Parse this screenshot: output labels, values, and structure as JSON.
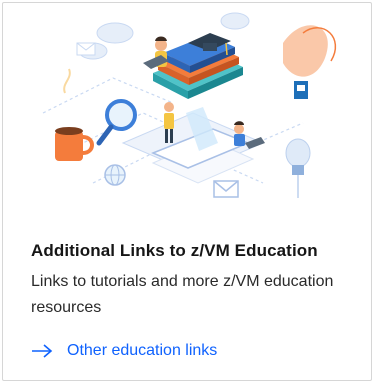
{
  "card": {
    "title": "Additional Links to z/VM Education",
    "description": "Links to tutorials and more z/VM education resources",
    "link_label": "Other education links",
    "link_icon": "arrow-right-icon",
    "illustration": "education-isometric-illustration"
  },
  "colors": {
    "link": "#0f62fe",
    "title": "#161616",
    "border": "#d6d6d6",
    "accent_orange": "#f47c3c",
    "accent_teal": "#4fc3c8",
    "accent_blue": "#3d7fd9"
  }
}
